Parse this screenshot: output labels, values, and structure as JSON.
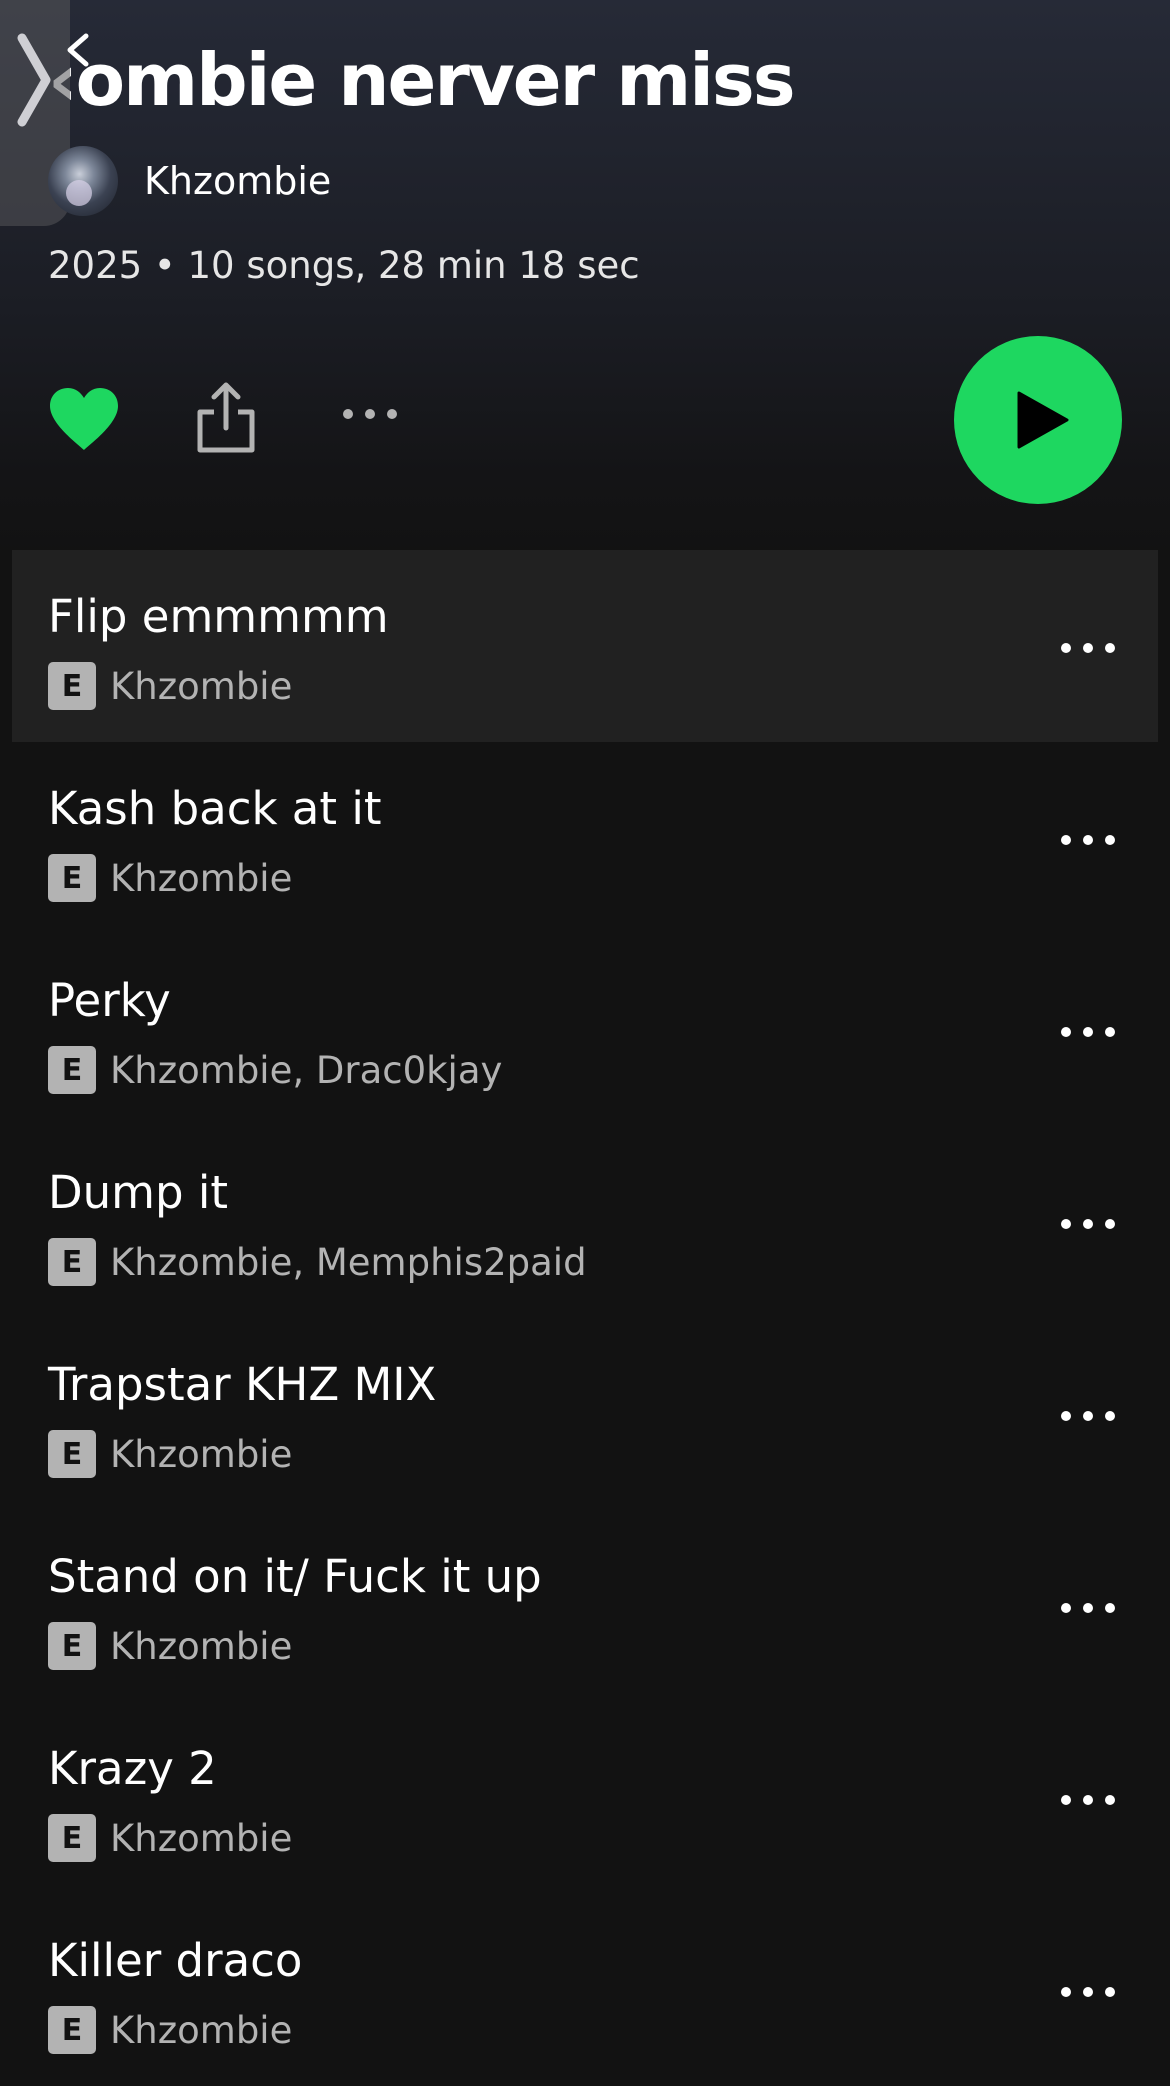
{
  "album": {
    "title": "Khzombie nerver miss",
    "visible_title": "‹ombie nerver miss",
    "artist": "Khzombie",
    "meta": "2025 • 10 songs, 28 min 18 sec"
  },
  "colors": {
    "accent": "#1ed760",
    "background": "#121212",
    "row_highlight": "#212121",
    "subtext": "#b3b3b3"
  },
  "actions": {
    "liked": true,
    "icons": [
      "heart-icon",
      "share-icon",
      "more-icon",
      "play-icon"
    ]
  },
  "explicit_badge": "E",
  "tracks": [
    {
      "title": "Flip emmmmm",
      "artists": "Khzombie",
      "explicit": true
    },
    {
      "title": "Kash back at it",
      "artists": "Khzombie",
      "explicit": true
    },
    {
      "title": "Perky",
      "artists": "Khzombie, Drac0kjay",
      "explicit": true
    },
    {
      "title": "Dump it",
      "artists": "Khzombie, Memphis2paid",
      "explicit": true
    },
    {
      "title": "Trapstar KHZ MIX",
      "artists": "Khzombie",
      "explicit": true
    },
    {
      "title": "Stand on it/ Fuck it up",
      "artists": "Khzombie",
      "explicit": true
    },
    {
      "title": "Krazy 2",
      "artists": "Khzombie",
      "explicit": true
    },
    {
      "title": "Killer draco",
      "artists": "Khzombie",
      "explicit": true
    }
  ]
}
